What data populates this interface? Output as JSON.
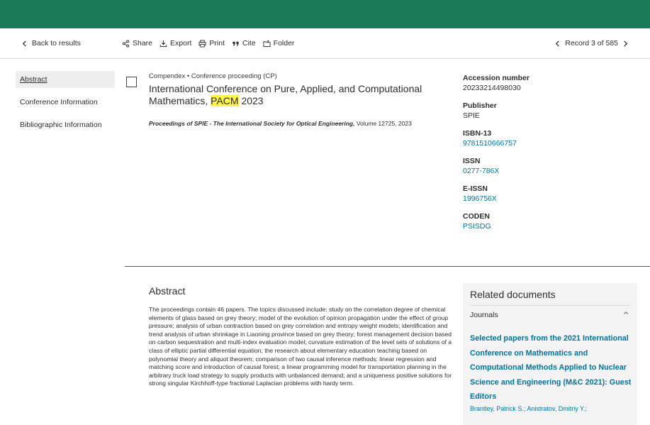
{
  "toolbar": {
    "back_label": "Back to results",
    "share_label": "Share",
    "export_label": "Export",
    "print_label": "Print",
    "cite_label": "Cite",
    "folder_label": "Folder",
    "record_label": "Record 3 of 585"
  },
  "sidebar": {
    "items": [
      {
        "label": "Abstract"
      },
      {
        "label": "Conference Information"
      },
      {
        "label": "Bibliographic Information"
      }
    ]
  },
  "record": {
    "meta": "Compendex • Conference proceeding (CP)",
    "title_before": "International Conference on Pure, Applied, and Computational Mathematics, ",
    "title_highlight": "PACM",
    "title_after": " 2023",
    "source_italic": "Proceedings of SPIE - The International Society for Optical Engineering,",
    "source_rest": " Volume 12725, 2023"
  },
  "details": {
    "accession_label": "Accession number",
    "accession_value": "20233214498030",
    "publisher_label": "Publisher",
    "publisher_value": "SPIE",
    "isbn_label": "ISBN-13",
    "isbn_value": "9781510666757",
    "issn_label": "ISSN",
    "issn_value": "0277-786X",
    "eissn_label": "E-ISSN",
    "eissn_value": "1996756X",
    "coden_label": "CODEN",
    "coden_value": "PSISDG"
  },
  "abstract": {
    "heading": "Abstract",
    "text": "The proceedings contain 46 papers. The topics discussed include: study on the correlation degree of chemical elements of glass based on grey theory; model of the evolution of opinion propagation under the effect of group pressure; analysis of urban contraction based on grey correlation and entropy weight models; identification and trend analysis of urban shrinkage in Liaoning province based on grey theory; forest management decision based on carbon sequestration and multi-index evaluation model; curvature estimation of the level sets of solutions of a class of elliptic partial differential equation; the research about elementary education teaching based on polynomial theory and aliquot theorem; comparison of two causal inference methods: linear regression and matching score and introduction of causal forest; a linear programming model for transportation planning in the arbitrary truck load strategy to supply products with unbalanced demand; and a uniqueness positive solutions for strong singular Kirchhoff-type fractional Laplacian problems with hardy term."
  },
  "related": {
    "heading": "Related documents",
    "journals_label": "Journals",
    "item_title": "Selected papers from the 2021 International Conference on Mathematics and Computational Methods Applied to Nuclear Science and Engineering (M&C 2021): Guest Editors",
    "item_authors": "Brantley, Patrick S.; Anistratov, Dmitriy Y.;"
  },
  "colors": {
    "brand_green": "#1a7a58",
    "link_blue": "#007398",
    "highlight": "#fff34d"
  }
}
